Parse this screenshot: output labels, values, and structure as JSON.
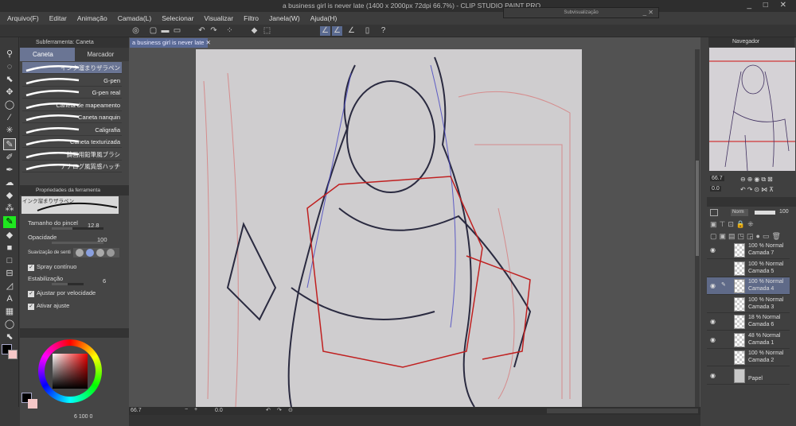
{
  "window": {
    "title": "a business girl is never late (1400 x 2000px 72dpi 66.7%)  - CLIP STUDIO PAINT PRO",
    "controls": "_ □ ✕"
  },
  "subview": {
    "title": "Subvisualização",
    "close": "_ ✕"
  },
  "menu": [
    "Arquivo(F)",
    "Editar",
    "Animação",
    "Camada(L)",
    "Selecionar",
    "Visualizar",
    "Filtro",
    "Janela(W)",
    "Ajuda(H)"
  ],
  "canvas_tab": {
    "label": "a business girl is never late ✕"
  },
  "subtool_panel": {
    "title": "Subferramenta: Caneta",
    "tabs": [
      "Caneta",
      "Marcador"
    ],
    "brushes": [
      "インク溜まりザラペン",
      "G-pen",
      "G-pen real",
      "Caneta de mapeamento",
      "Caneta nanquin",
      "Caligrafia",
      "Caneta texturizada",
      "鋳画用鉛筆風ブラシ",
      "アナログ風質感ハッチ"
    ]
  },
  "tool_property": {
    "title": "Propriedades da ferramenta",
    "brush_name": "インク溜まりザラペン",
    "brush_size_label": "Tamanho do pincel",
    "brush_size": "12.8",
    "opacity_label": "Opacidade",
    "opacity": "100",
    "antialias_label": "Suavização de senti",
    "spray_label": "Spray contínuo",
    "stabilization_label": "Estabilização",
    "stabilization": "6",
    "speed_label": "Ajustar por velocidade",
    "adjust_label": "Ativar ajuste"
  },
  "color": {
    "main": "#000000",
    "sub": "#f6c8c8",
    "readout": "6  100  0"
  },
  "status": {
    "zoom": "66.7",
    "angle": "0.0"
  },
  "navigator": {
    "title": "Navegador",
    "zoom": "66.7",
    "angle": "0.0"
  },
  "layer_panel": {
    "blend": "Norm",
    "opacity": "100",
    "layers": [
      {
        "mode": "100 % Normal",
        "name": "Camada 7",
        "visible": true
      },
      {
        "mode": "100 % Normal",
        "name": "Camada 5",
        "visible": false
      },
      {
        "mode": "100 % Normal",
        "name": "Camada 4",
        "visible": true,
        "selected": true
      },
      {
        "mode": "100 % Normal",
        "name": "Camada 3",
        "visible": false
      },
      {
        "mode": "18 % Normal",
        "name": "Camada 6",
        "visible": true
      },
      {
        "mode": "48 % Normal",
        "name": "Camada 1",
        "visible": true
      },
      {
        "mode": "100 % Normal",
        "name": "Camada 2",
        "visible": false
      },
      {
        "mode": "",
        "name": "Papel",
        "visible": true
      }
    ]
  }
}
